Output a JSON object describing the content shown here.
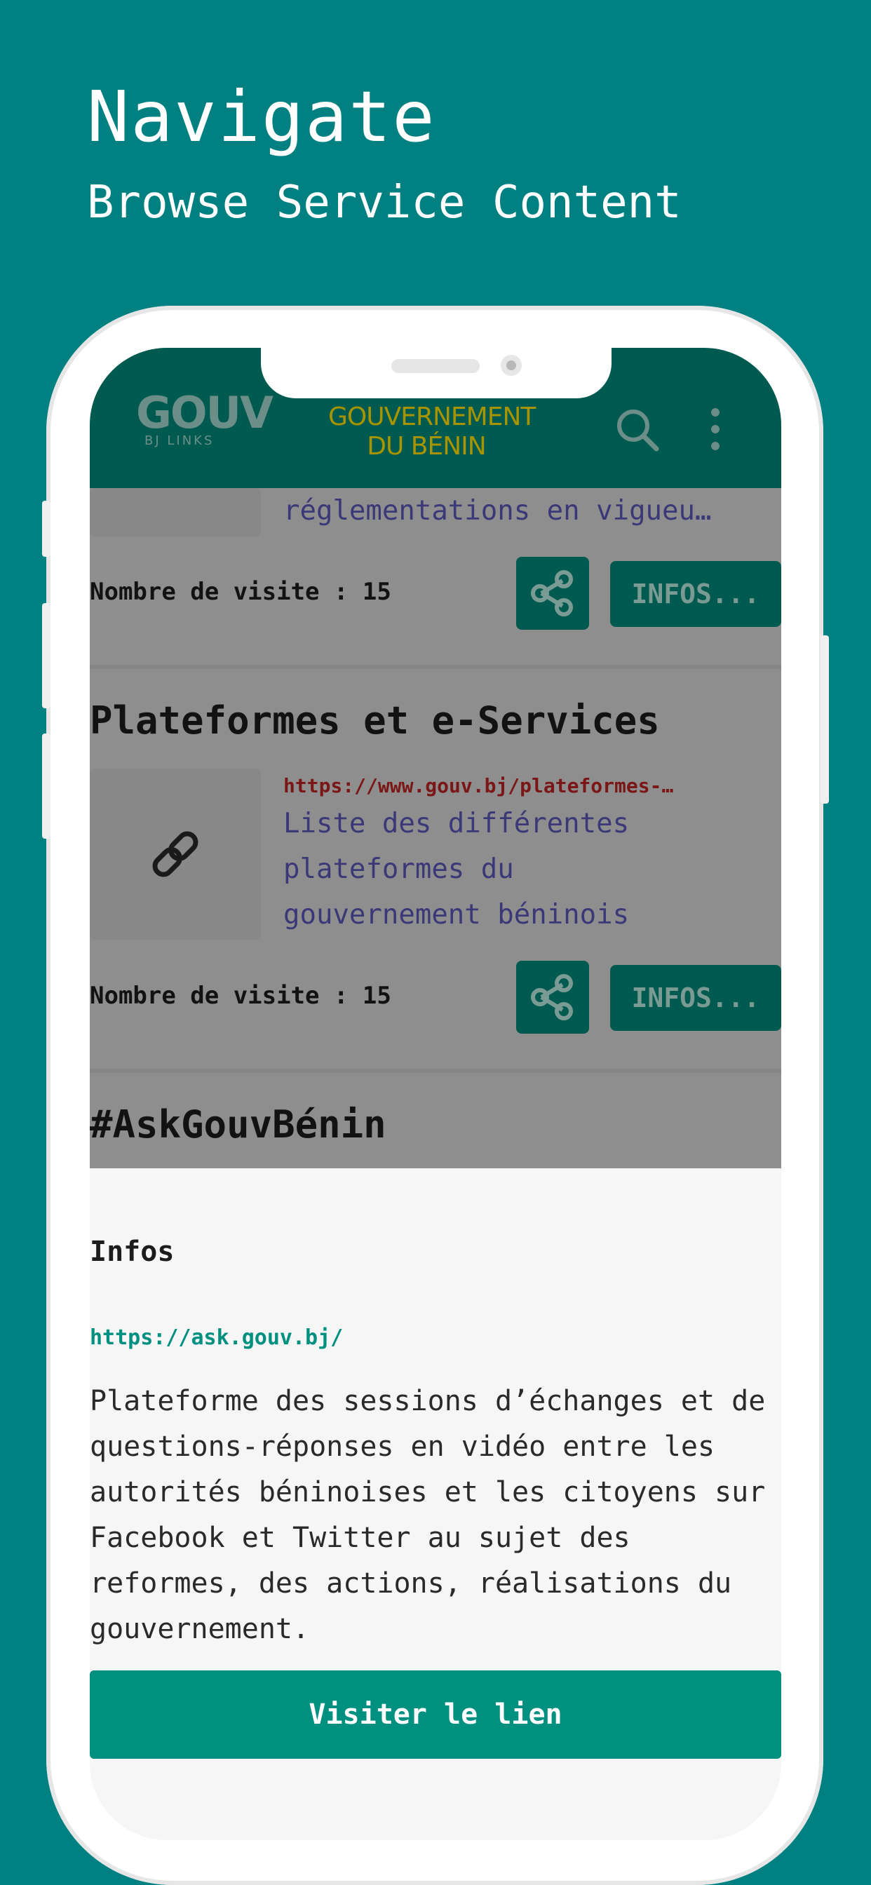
{
  "hero": {
    "title": "Navigate",
    "subtitle": "Browse Service Content"
  },
  "appbar": {
    "logo_main": "GOUV",
    "logo_small": "BJ LINKS",
    "title_line1": "GOUVERNEMENT",
    "title_line2": "DU BÉNIN",
    "search_icon": "search-icon",
    "menu_icon": "more-vertical-icon"
  },
  "list": {
    "card1": {
      "desc_partial": "réglementations en vigueu…",
      "visits": "Nombre de visite : 15",
      "infos_label": "INFOS..."
    },
    "card2": {
      "title": "Plateformes et e-Services",
      "url": "https://www.gouv.bj/plateformes-…",
      "desc_line1": "Liste des différentes",
      "desc_line2": "plateformes du",
      "desc_line3": "gouvernement béninois",
      "visits": "Nombre de visite : 15",
      "infos_label": "INFOS...",
      "thumb_icon": "link-icon"
    },
    "card3": {
      "title": "#AskGouvBénin"
    }
  },
  "sheet": {
    "title": "Infos",
    "url": "https://ask.gouv.bj/",
    "description": "Plateforme des sessions d’échanges et de questions-réponses en vidéo entre les autorités béninoises et les citoyens sur Facebook et Twitter au sujet des reformes, des actions, réalisations du gouvernement.",
    "button_label": "Visiter le lien"
  },
  "colors": {
    "background": "#008080",
    "appbar": "#005a4f",
    "accent": "#009080",
    "title_gold": "#a89400"
  }
}
